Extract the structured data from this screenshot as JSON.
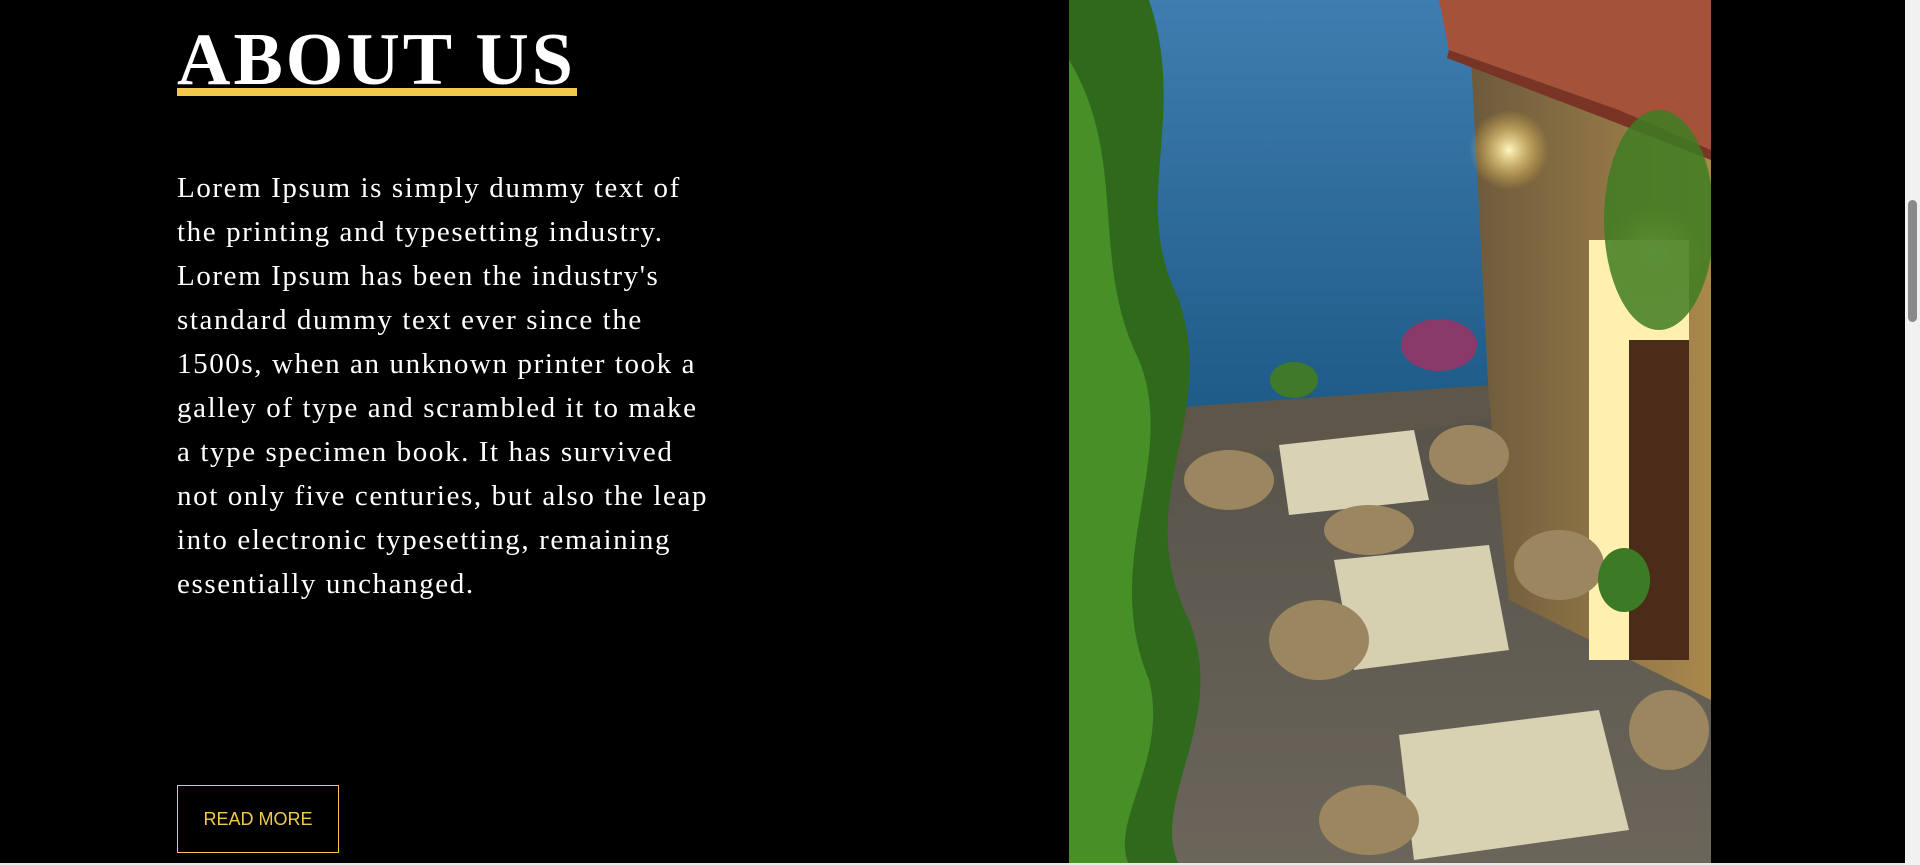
{
  "about": {
    "title": "ABOUT US",
    "body": "Lorem Ipsum is simply dummy text of the printing and typesetting industry. Lorem Ipsum has been the industry's standard dummy text ever since the 1500s, when an unknown printer took a galley of type and scrambled it to make a type specimen book. It has survived not only five centuries, but also the leap into electronic typesetting, remaining essentially unchanged.",
    "read_more_label": "READ MORE"
  },
  "colors": {
    "background": "#000000",
    "accent": "#f2c94c",
    "text": "#ffffff"
  }
}
